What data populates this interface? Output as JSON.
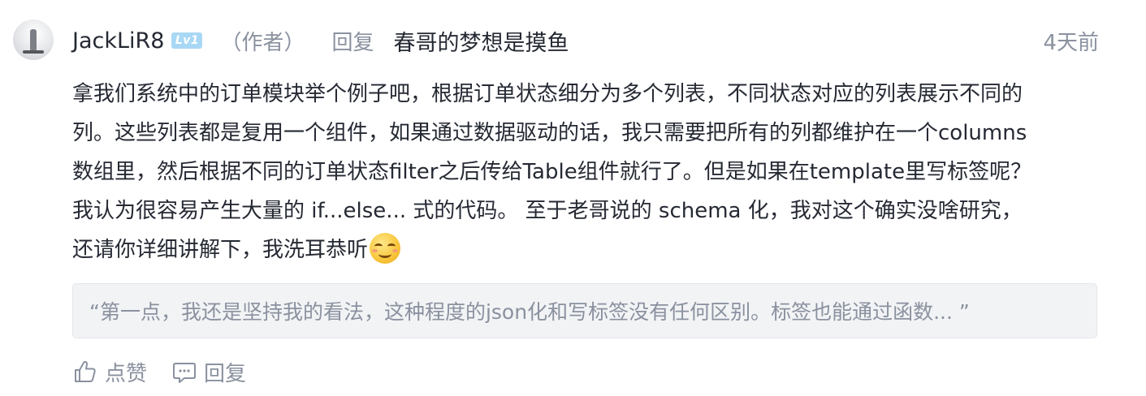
{
  "comment": {
    "author": {
      "name": "JackLiR8",
      "level": "Lv1",
      "author_tag": "（作者）"
    },
    "reply_word": "回复",
    "reply_to": "春哥的梦想是摸鱼",
    "time": "4天前",
    "content_lines": [
      "拿我们系统中的订单模块举个例子吧，根据订单状态细分为多个列表，不同状态对应的列表展示不同的",
      "列。这些列表都是复用一个组件，如果通过数据驱动的话，我只需要把所有的列都维护在一个columns",
      "数组里，然后根据不同的订单状态filter之后传给Table组件就行了。但是如果在template里写标签呢？",
      "我认为很容易产生大量的 if...else... 式的代码。 至于老哥说的 schema 化，我对这个确实没啥研究，",
      "还请你详细讲解下，我洗耳恭听"
    ],
    "content_emoji": "smile-emoji",
    "quote": "“第一点，我还是坚持我的看法，这种程度的json化和写标签没有任何区别。标签也能通过函数... ”",
    "actions": {
      "like_label": "点赞",
      "reply_label": "回复"
    }
  },
  "icons": {
    "like": "thumbs-up-icon",
    "reply": "comment-bubble-icon"
  },
  "colors": {
    "text_primary": "#252933",
    "text_secondary": "#8a919f",
    "level_badge": "#a9d8f4",
    "quote_background": "#f2f3f5"
  }
}
